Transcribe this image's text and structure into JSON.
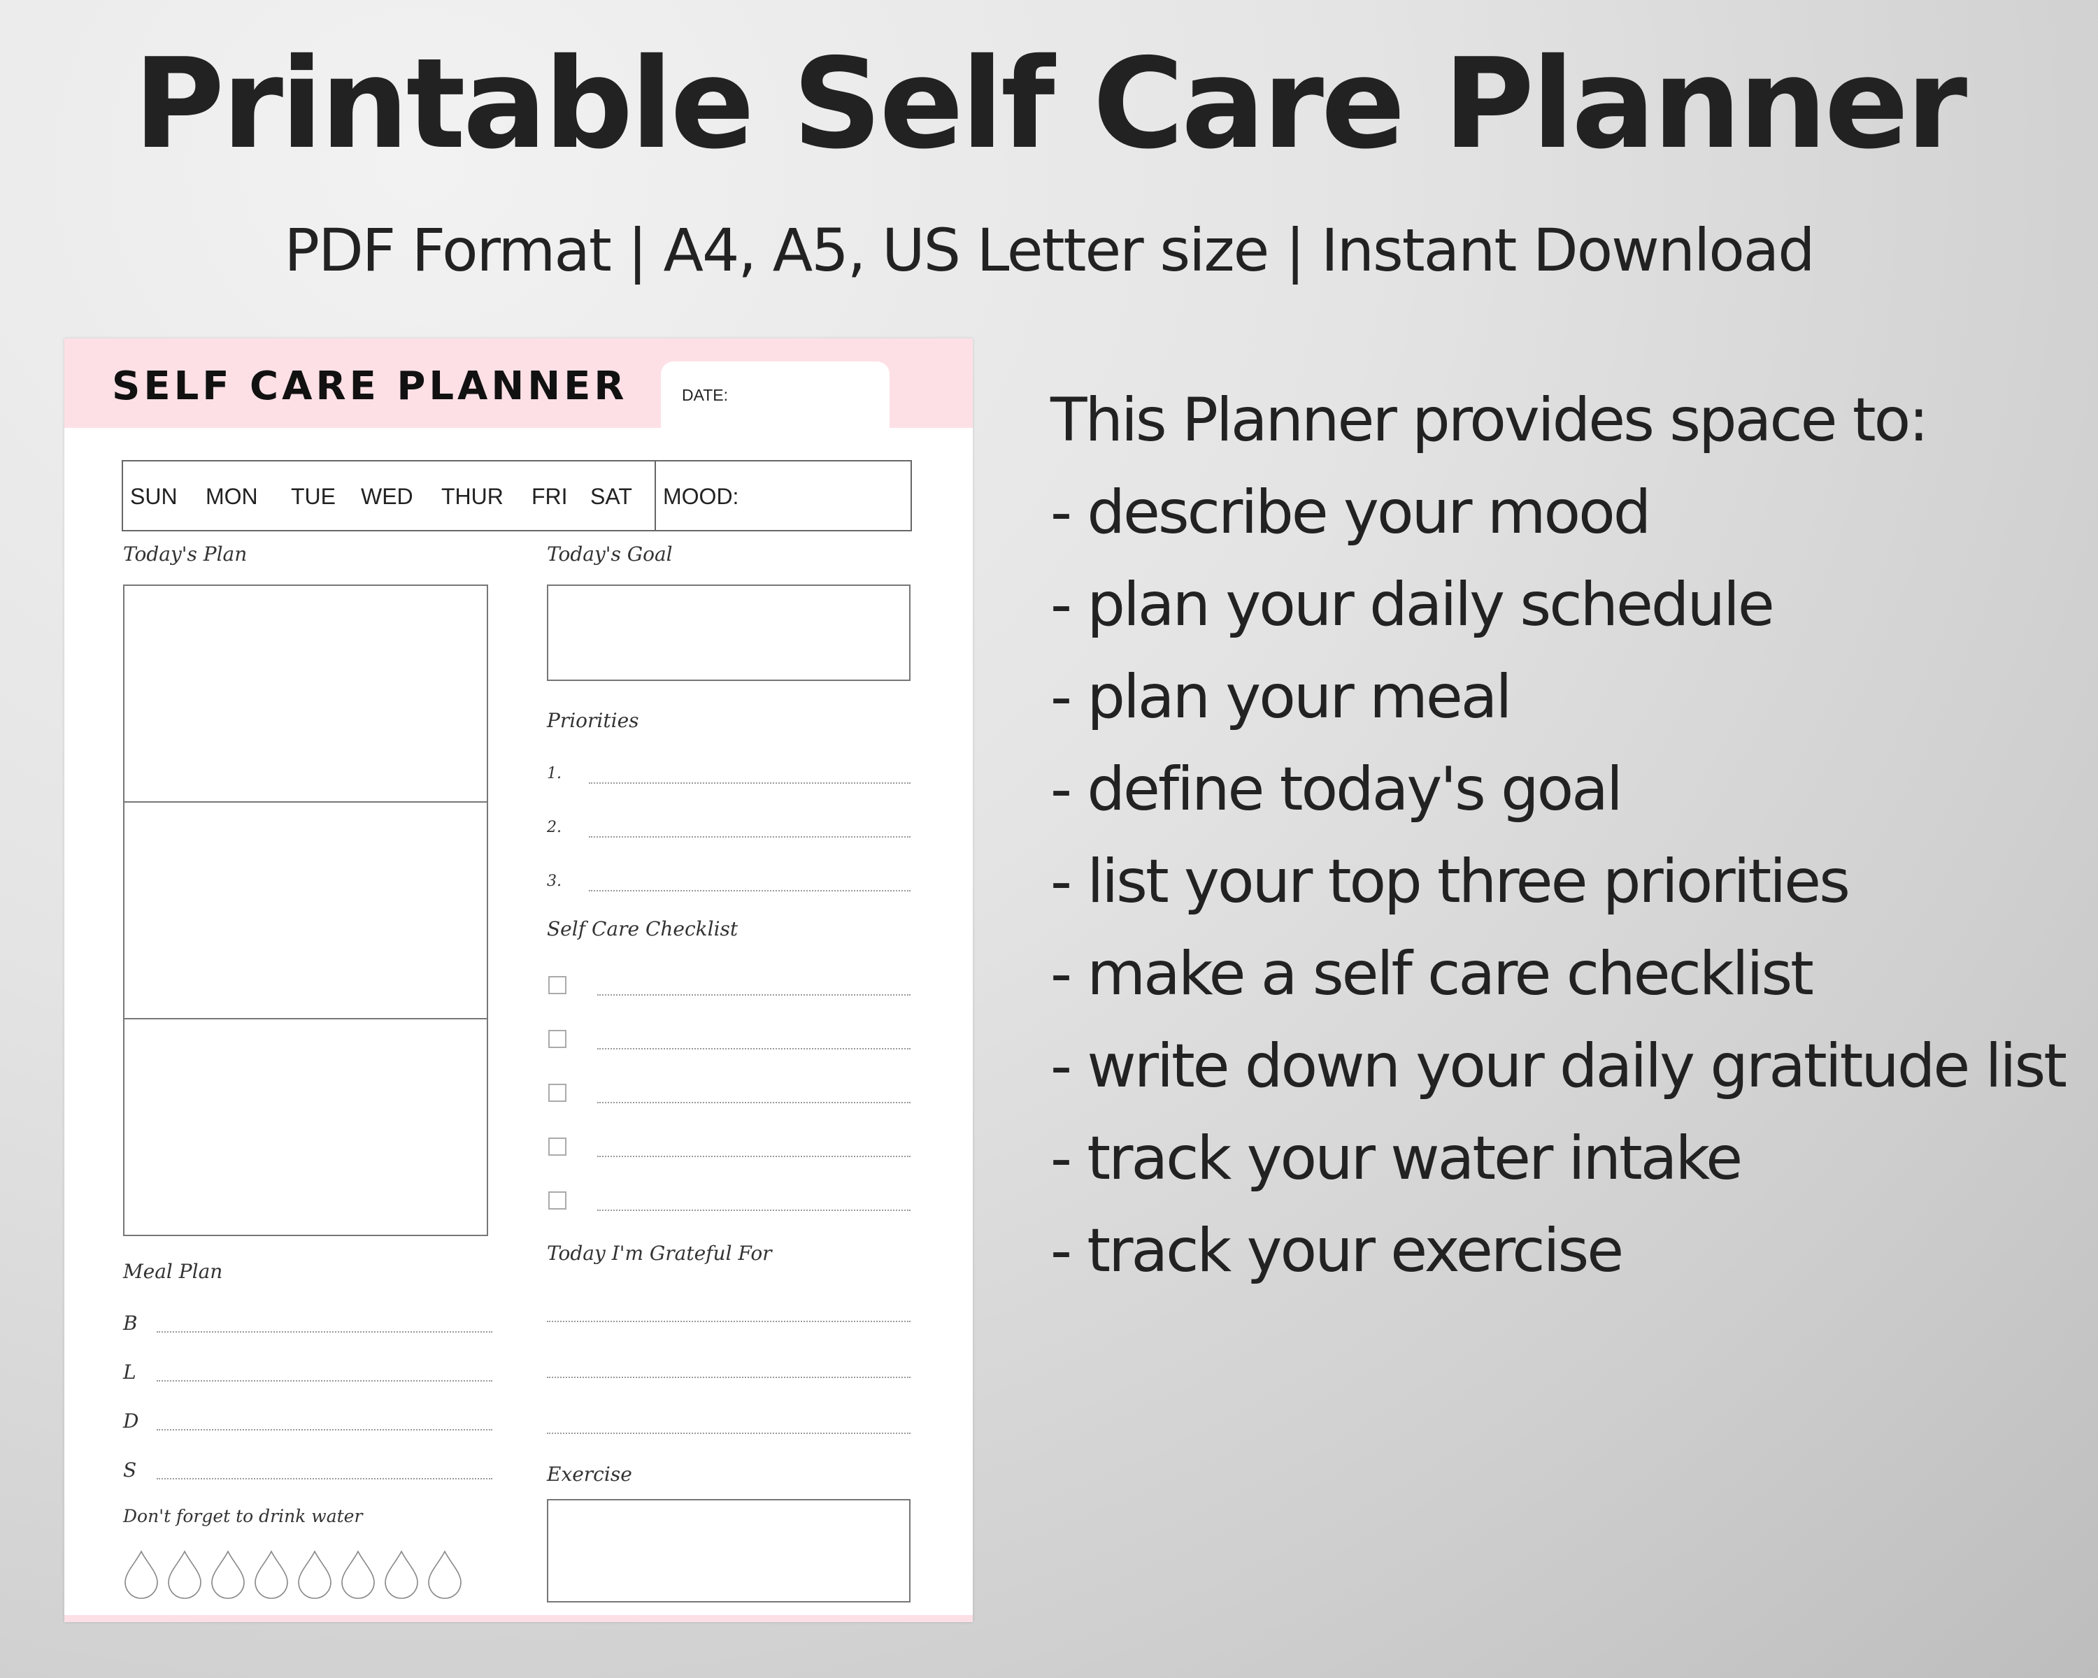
{
  "banner": {
    "title": "Printable Self Care Planner",
    "subtitle": "PDF Format | A4, A5, US Letter size | Instant Download"
  },
  "planner": {
    "title": "SELF CARE PLANNER",
    "date_label": "DATE:",
    "days": [
      "SUN",
      "MON",
      "TUE",
      "WED",
      "THUR",
      "FRI",
      "SAT"
    ],
    "mood_label": "MOOD:",
    "todays_plan": "Today's Plan",
    "todays_goal": "Today's Goal",
    "priorities": {
      "heading": "Priorities",
      "items": [
        "1.",
        "2.",
        "3."
      ]
    },
    "checklist": {
      "heading": "Self Care Checklist",
      "count": 5
    },
    "meal_plan": {
      "heading": "Meal Plan",
      "meals": [
        "B",
        "L",
        "D",
        "S"
      ]
    },
    "water": {
      "heading": "Don't forget to drink water",
      "drops": 8
    },
    "grateful": {
      "heading": "Today I'm Grateful For",
      "lines": 3
    },
    "exercise": "Exercise",
    "colors": {
      "accent_pink": "#fde0e6",
      "ink": "#222222"
    }
  },
  "description": {
    "intro": "This Planner provides space to:",
    "items": [
      "- describe your mood",
      "- plan your daily schedule",
      "- plan your meal",
      "- define today's goal",
      "- list your top three priorities",
      "- make a self care checklist",
      "- write down your daily gratitude list",
      "- track your water intake",
      "- track your exercise"
    ]
  }
}
